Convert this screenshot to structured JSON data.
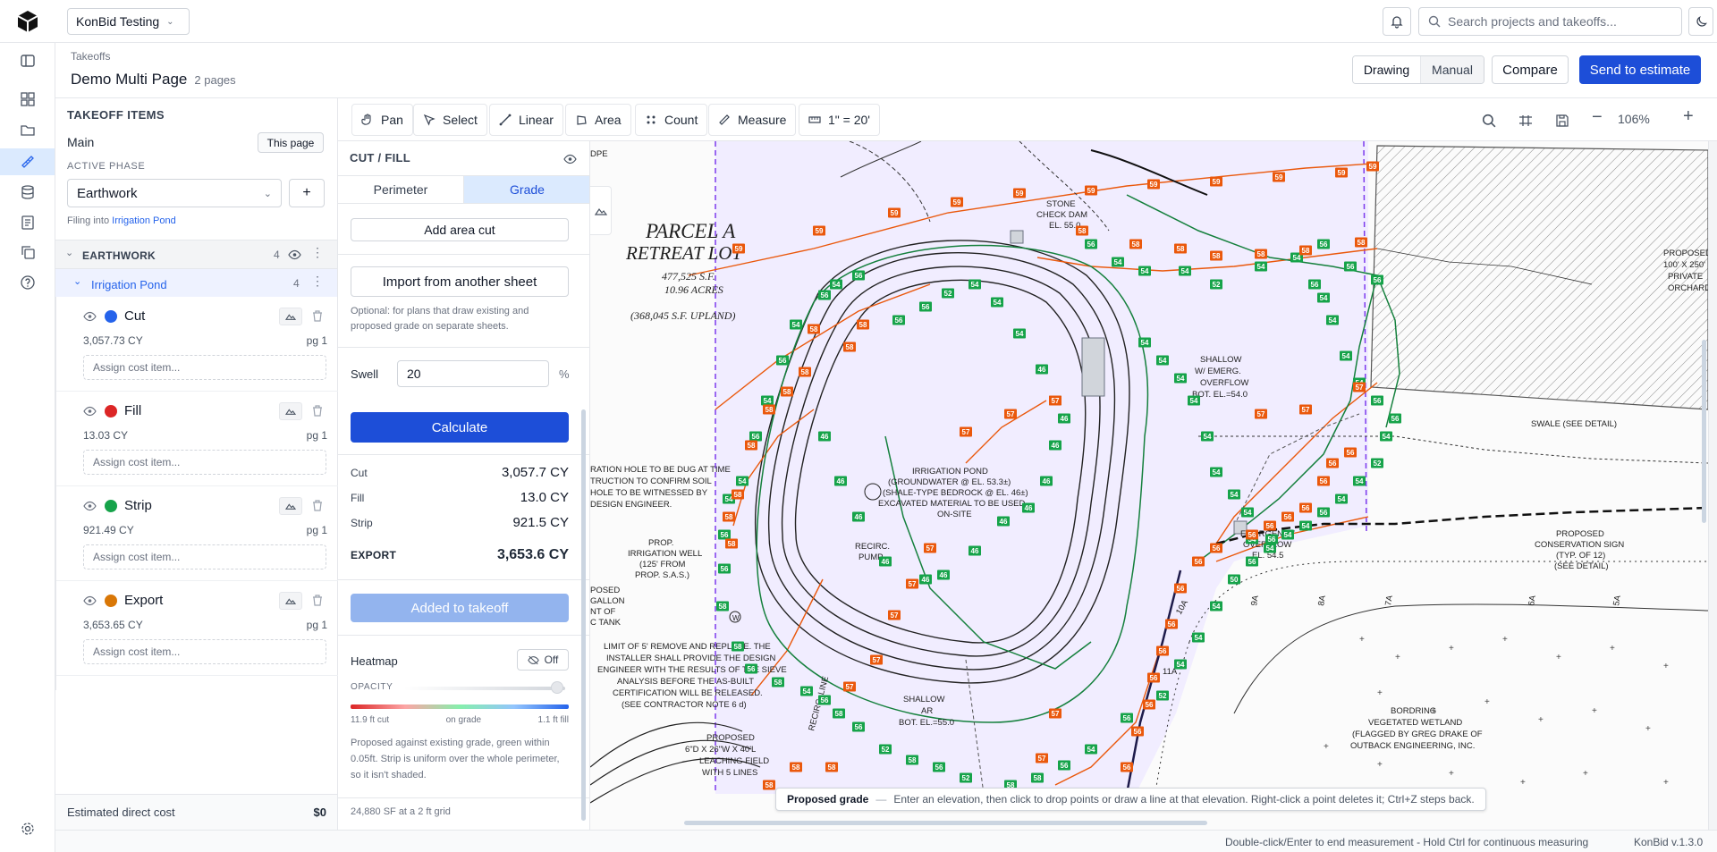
{
  "topbar": {
    "workspace": "KonBid Testing",
    "search_placeholder": "Search projects and takeoffs..."
  },
  "header": {
    "breadcrumb": "Takeoffs",
    "title": "Demo Multi Page",
    "pages": "2 pages",
    "mode_drawing": "Drawing",
    "mode_manual": "Manual",
    "compare": "Compare",
    "send": "Send to estimate"
  },
  "left": {
    "section_title": "TAKEOFF ITEMS",
    "scope": "Main",
    "this_page": "This page",
    "active_phase_label": "ACTIVE PHASE",
    "phase": "Earthwork",
    "filing_prefix": "Filing into",
    "filing_target": "Irrigation Pond",
    "group": "EARTHWORK",
    "group_count": "4",
    "subgroup": "Irrigation Pond",
    "subgroup_count": "4",
    "items": [
      {
        "name": "Cut",
        "qty": "3,057.73 CY",
        "page": "pg 1",
        "color": "#2563eb",
        "assign": "Assign cost item..."
      },
      {
        "name": "Fill",
        "qty": "13.03 CY",
        "page": "pg 1",
        "color": "#dc2626",
        "assign": "Assign cost item..."
      },
      {
        "name": "Strip",
        "qty": "921.49 CY",
        "page": "pg 1",
        "color": "#16a34a",
        "assign": "Assign cost item..."
      },
      {
        "name": "Export",
        "qty": "3,653.65 CY",
        "page": "pg 1",
        "color": "#d97706",
        "assign": "Assign cost item..."
      }
    ],
    "est_label": "Estimated direct cost",
    "est_value": "$0"
  },
  "toolbar": {
    "pan": "Pan",
    "select": "Select",
    "linear": "Linear",
    "area": "Area",
    "count": "Count",
    "measure": "Measure",
    "scale": "1\" = 20'",
    "zoom": "106%"
  },
  "cutfill": {
    "title": "CUT / FILL",
    "tab_perimeter": "Perimeter",
    "tab_grade": "Grade",
    "add_area_cut": "Add area cut",
    "import": "Import from another sheet",
    "import_note": "Optional: for plans that draw existing and proposed grade on separate sheets.",
    "swell_label": "Swell",
    "swell_value": "20",
    "swell_unit": "%",
    "calculate": "Calculate",
    "results": [
      {
        "label": "Cut",
        "value": "3,057.7 CY"
      },
      {
        "label": "Fill",
        "value": "13.0 CY"
      },
      {
        "label": "Strip",
        "value": "921.5 CY"
      }
    ],
    "export_label": "EXPORT",
    "export_value": "3,653.6 CY",
    "added": "Added to takeoff",
    "heatmap": "Heatmap",
    "heatmap_state": "Off",
    "opacity": "OPACITY",
    "opacity_level": 0.95,
    "scale_cut": "11.9 ft cut",
    "scale_mid": "on grade",
    "scale_fill": "1.1 ft fill",
    "note": "Proposed against existing grade, green within 0.05ft. Strip is uniform over the whole perimeter, so it isn't shaded.",
    "footer": "24,880 SF at a 2 ft grid"
  },
  "canvas": {
    "hint_title": "Proposed grade",
    "hint_sep": "—",
    "hint_text": "Enter an elevation, then click to drop points or draw a line at that elevation. Right-click a point deletes it; Ctrl+Z steps back.",
    "plan_labels": {
      "parcel": "PARCEL A",
      "retreat": "RETREAT LOT",
      "sf": "477,525 S.F.",
      "acres": "10.96 ACRES",
      "upland": "(368,045 S.F. UPLAND)",
      "stone": "STONE",
      "checkdam": "CHECK DAM",
      "el55": "EL. 55.0",
      "shallow1": "SHALLOW",
      "emerg": "W/ EMERG.",
      "overflow": "OVERFLOW",
      "bot54": "BOT. EL.=54.0",
      "pond1": "IRRIGATION POND",
      "pond2": "(GROUNDWATER @ EL. 53.3±)",
      "pond3": "(SHALE-TYPE BEDROCK @ EL. 46±)",
      "pond4": "EXCAVATED MATERIAL TO BE USED",
      "pond5": "ON-SITE",
      "recirc1": "RECIRC.",
      "recirc2": "PUMP",
      "emov1": "EMERGENCY",
      "emov2": "OVERFLOW",
      "emov3": "EL. 54.5",
      "swale": "SWALE (SEE DETAIL)",
      "cons1": "PROPOSED",
      "cons2": "CONSERVATION SIGN",
      "cons3": "(TYP. OF 12)",
      "cons4": "(SEE DETAIL)",
      "orch1": "PROPOSED",
      "orch2": "100' X 250'",
      "orch3": "PRIVATE",
      "orch4": "ORCHARD",
      "well1": "PROP.",
      "well2": "IRRIGATION WELL",
      "well3": "(125' FROM",
      "well4": "PROP. S.A.S.)",
      "hole1": "RATION HOLE TO BE DUG AT TIME",
      "hole2": "TRUCTION TO CONFIRM SOIL",
      "hole3": "HOLE TO BE WITNESSED BY",
      "hole4": "DESIGN ENGINEER.",
      "tank1": "POSED",
      "tank2": "GALLON",
      "tank3": "NT OF",
      "tank4": "C TANK",
      "limit1": "LIMIT OF 5' REMOVE AND REPLACE. THE",
      "limit2": "INSTALLER SHALL PROVIDE THE DESIGN",
      "limit3": "ENGINEER WITH THE RESULTS OF THE SIEVE",
      "limit4": "ANALYSIS BEFORE THE AS-BUILT",
      "limit5": "CERTIFICATION WILL BE RELEASED.",
      "limit6": "(SEE CONTRACTOR NOTE 6 d)",
      "leach1": "PROPOSED",
      "leach2": "6\"D X 26\"W X 40'L",
      "leach3": "LEACHING FIELD",
      "leach4": "WITH 5 LINES",
      "wet1": "BORDRING",
      "wet2": "VEGETATED WETLAND",
      "wet3": "(FLAGGED BY GREG DRAKE OF",
      "wet4": "OUTBACK ENGINEERING, INC.",
      "sp1": "SHALLOW",
      "sp2": "AR",
      "sp3": "BOT. EL.=55.0",
      "dpe": "DPE",
      "recircline": "RECIRC. LINE",
      "n11a": "11A",
      "n10a": "10A",
      "n9a": "9A",
      "n8a": "8A",
      "n7a": "7A",
      "n6a": "6A",
      "n5a": "5A",
      "w": "W"
    }
  },
  "status": {
    "hint": "Double-click/Enter to end measurement - Hold Ctrl for continuous measuring",
    "version": "KonBid v.1.3.0"
  }
}
